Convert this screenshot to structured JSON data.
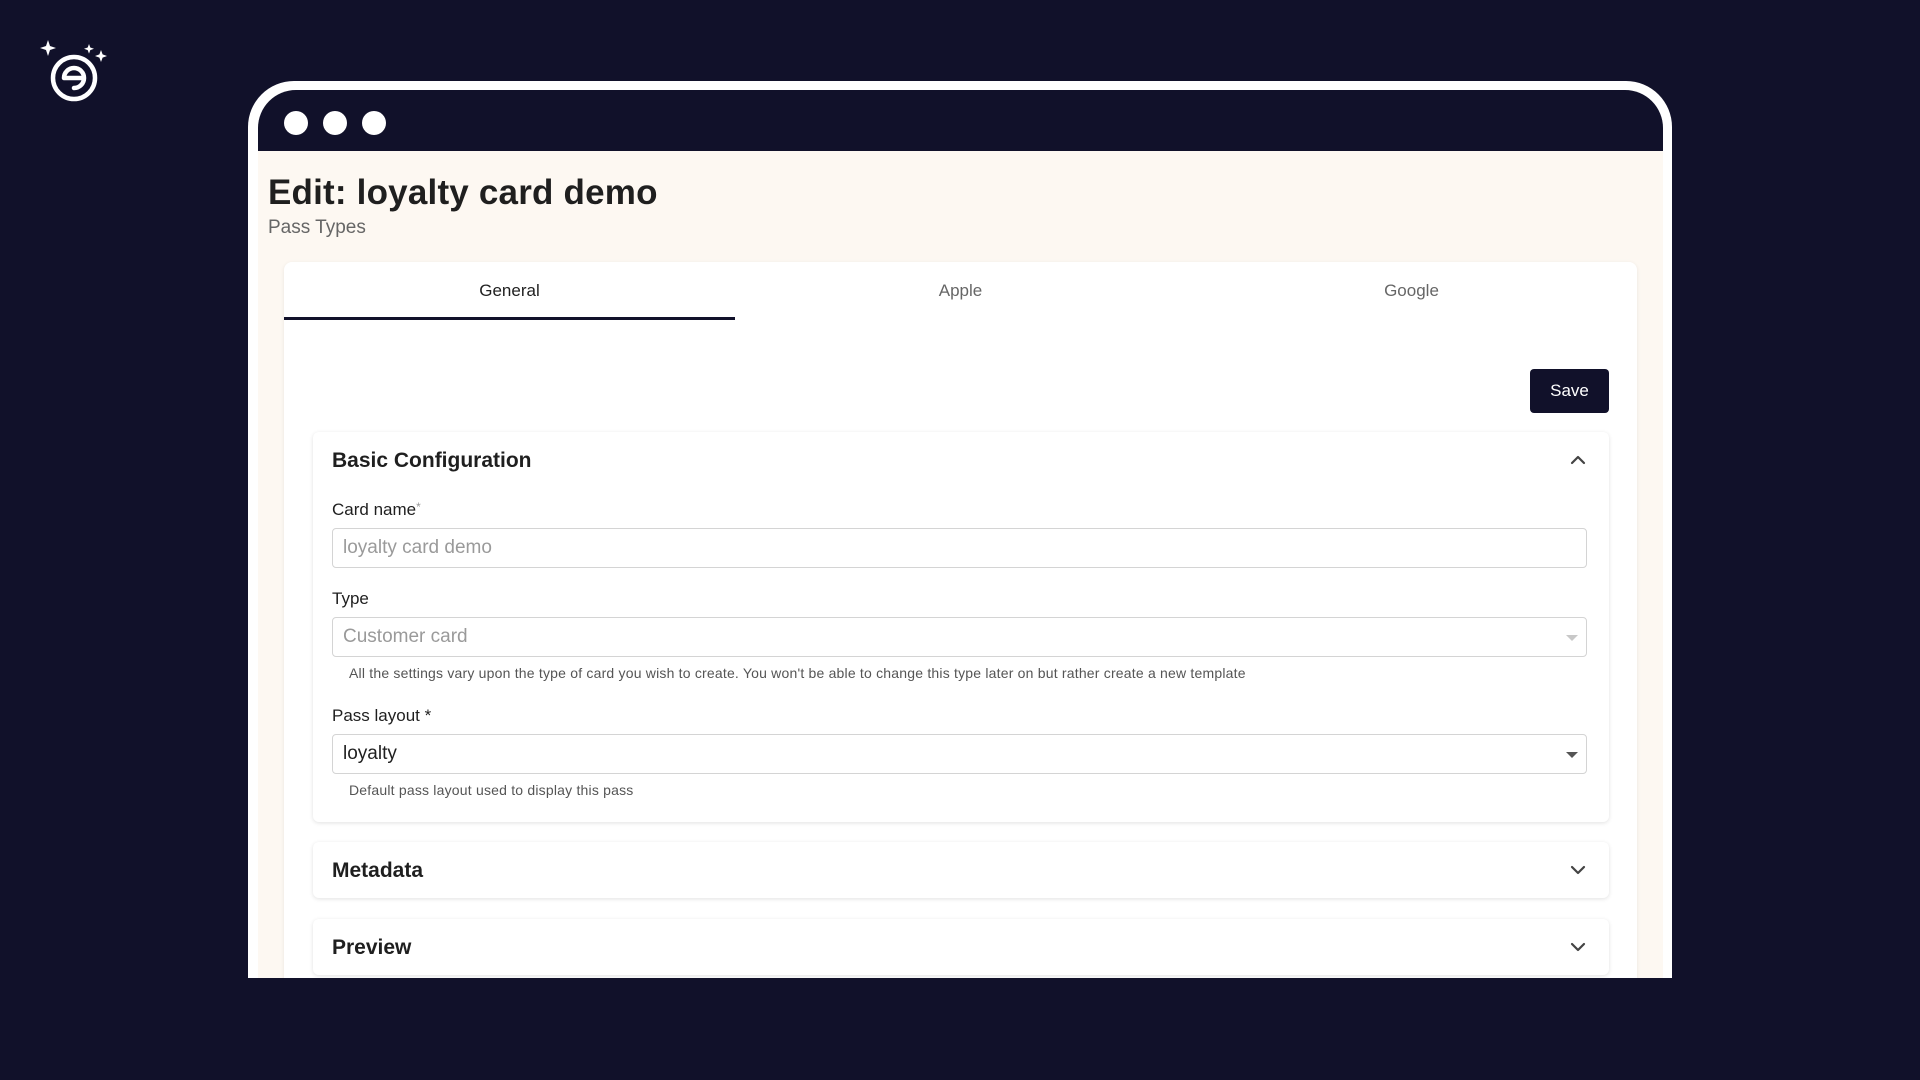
{
  "branding": {
    "logo_icon": "sparkle-e-logo"
  },
  "page": {
    "title": "Edit: loyalty card demo",
    "subtitle": "Pass Types"
  },
  "tabs": [
    {
      "label": "General",
      "active": true
    },
    {
      "label": "Apple",
      "active": false
    },
    {
      "label": "Google",
      "active": false
    }
  ],
  "toolbar": {
    "save_label": "Save"
  },
  "sections": {
    "basic": {
      "title": "Basic Configuration",
      "expanded": true,
      "card_name": {
        "label": "Card name",
        "required_mark": "*",
        "value": "loyalty card demo"
      },
      "type": {
        "label": "Type",
        "value": "Customer card",
        "helper": "All the settings vary upon the type of card you wish to create. You won't be able to change this type later on but rather create a new template"
      },
      "pass_layout": {
        "label": "Pass layout *",
        "value": "loyalty",
        "helper": "Default pass layout used to display this pass"
      }
    },
    "metadata": {
      "title": "Metadata",
      "expanded": false
    },
    "preview": {
      "title": "Preview",
      "expanded": false
    }
  },
  "colors": {
    "background": "#11112a",
    "page_background": "#fdf8f2",
    "accent": "#11112a"
  }
}
